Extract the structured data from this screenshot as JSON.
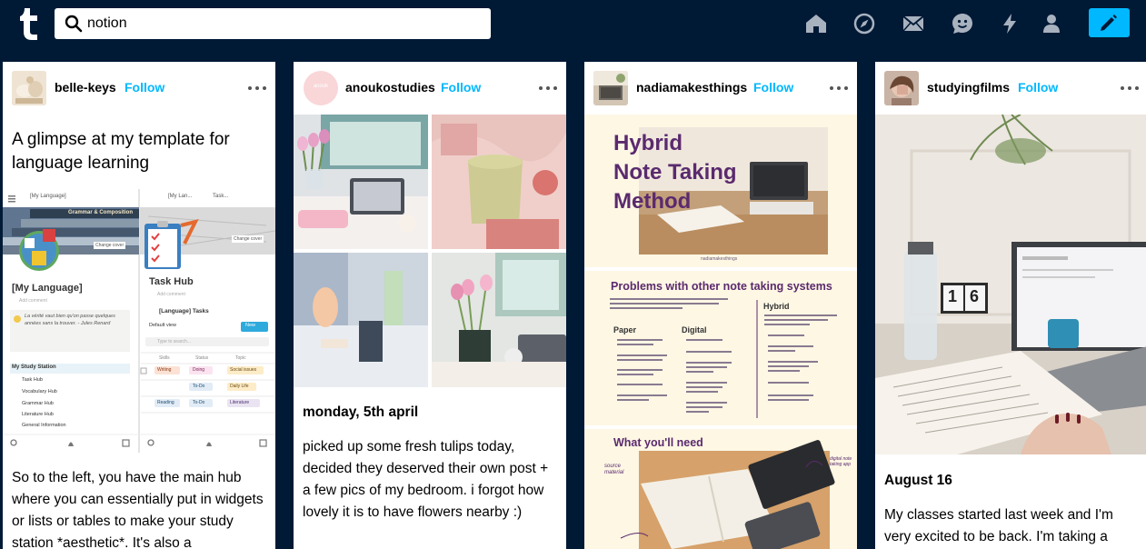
{
  "header": {
    "search_value": "notion",
    "icons": [
      "tumblr-logo-icon",
      "search-icon",
      "home-icon",
      "explore-icon",
      "inbox-icon",
      "messages-icon",
      "activity-icon",
      "account-icon",
      "compose-icon"
    ],
    "accent_color": "#00b8ff",
    "background_color": "#001935"
  },
  "posts": [
    {
      "blog": "belle-keys",
      "follow": "Follow",
      "title": "A glimpse at my template for language learning",
      "body": "So to the left, you have the main hub where you can essentially put in widgets or lists or tables to make your study station *aesthetic*. It's also a",
      "image_text": {
        "crumb_left": "[My Language]",
        "crumb_right_a": "[My Lan...",
        "crumb_right_b": "Task...",
        "banner_text": "Grammar & Composition",
        "change_cover": "Change cover",
        "page_title_left": "[My Language]",
        "add_comment": "Add comment",
        "quote": "La vérité vaut bien qu'on passe quelques années sans la trouver. - Jules Renard",
        "section_title": "My Study Station",
        "hub_items": [
          "Task Hub",
          "Vocabulary Hub",
          "Grammar Hub",
          "Literature Hub",
          "General Information"
        ],
        "page_title_right": "Task Hub",
        "tasks_label": "[Language] Tasks",
        "default_view": "Default view",
        "new_label": "New",
        "search_ph": "Type to search...",
        "columns": [
          "Skills",
          "Status",
          "Topic"
        ],
        "rows": [
          [
            "Writing",
            "Doing",
            "Social issues"
          ],
          [
            "",
            "To-Do",
            "Daily Life"
          ],
          [
            "Reading",
            "To-Do",
            "Literature"
          ]
        ]
      }
    },
    {
      "blog": "anoukostudies",
      "follow": "Follow",
      "avatar_text": "anouk",
      "heading": "monday, 5th april",
      "body": "picked up some fresh tulips today, decided they deserved their own post + a few pics of my bedroom. i forgot how lovely it is to have flowers nearby :)"
    },
    {
      "blog": "nadiamakesthings",
      "follow": "Follow",
      "slide1_title": [
        "Hybrid",
        "Note Taking",
        "Method"
      ],
      "slide1_credit": "nadiamakesthings",
      "slide2_title": "Problems with other note taking systems",
      "slide2_cols": [
        "Paper",
        "Digital",
        "Hybrid"
      ],
      "slide3_title": "What you'll need",
      "slide3_labels": [
        "source material",
        "digital note taking app"
      ]
    },
    {
      "blog": "studyingfilms",
      "follow": "Follow",
      "heading": "August 16",
      "body": "My classes started last week and I'm very excited to be back. I'm taking a",
      "calendar": [
        "1",
        "6"
      ]
    }
  ]
}
